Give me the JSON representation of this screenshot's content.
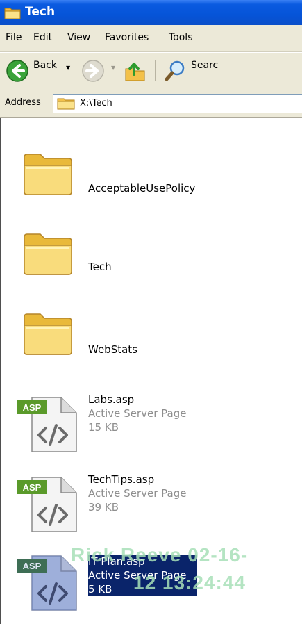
{
  "window": {
    "title": "Tech",
    "icon": "folder-icon"
  },
  "menu": [
    "File",
    "Edit",
    "View",
    "Favorites",
    "Tools"
  ],
  "toolbar": {
    "back_label": "Back",
    "search_label": "Searc",
    "icons": [
      "back-arrow-icon",
      "forward-arrow-icon",
      "up-folder-icon",
      "search-magnifier-icon"
    ]
  },
  "address": {
    "label": "Address",
    "path": "X:\\Tech"
  },
  "folders": [
    {
      "name": "AcceptableUsePolicy"
    },
    {
      "name": "Tech"
    },
    {
      "name": "WebStats"
    }
  ],
  "files": [
    {
      "name": "Labs.asp",
      "type": "Active Server Page",
      "size": "15 KB",
      "badge": "ASP",
      "selected": false
    },
    {
      "name": "TechTips.asp",
      "type": "Active Server Page",
      "size": "39 KB",
      "badge": "ASP",
      "selected": false
    },
    {
      "name": "IT Plan.asp",
      "type": "Active Server Page",
      "size": "5 KB",
      "badge": "ASP",
      "selected": true
    }
  ],
  "watermark": {
    "line1": "Rick Reeve 02-16-",
    "line2": "12 13:24:44"
  },
  "colors": {
    "titlebar": "#0654d8",
    "chrome": "#ece9d8",
    "selection": "#0a246a",
    "asp_badge": "#5a9a2a",
    "folder": "#f7d36a"
  }
}
